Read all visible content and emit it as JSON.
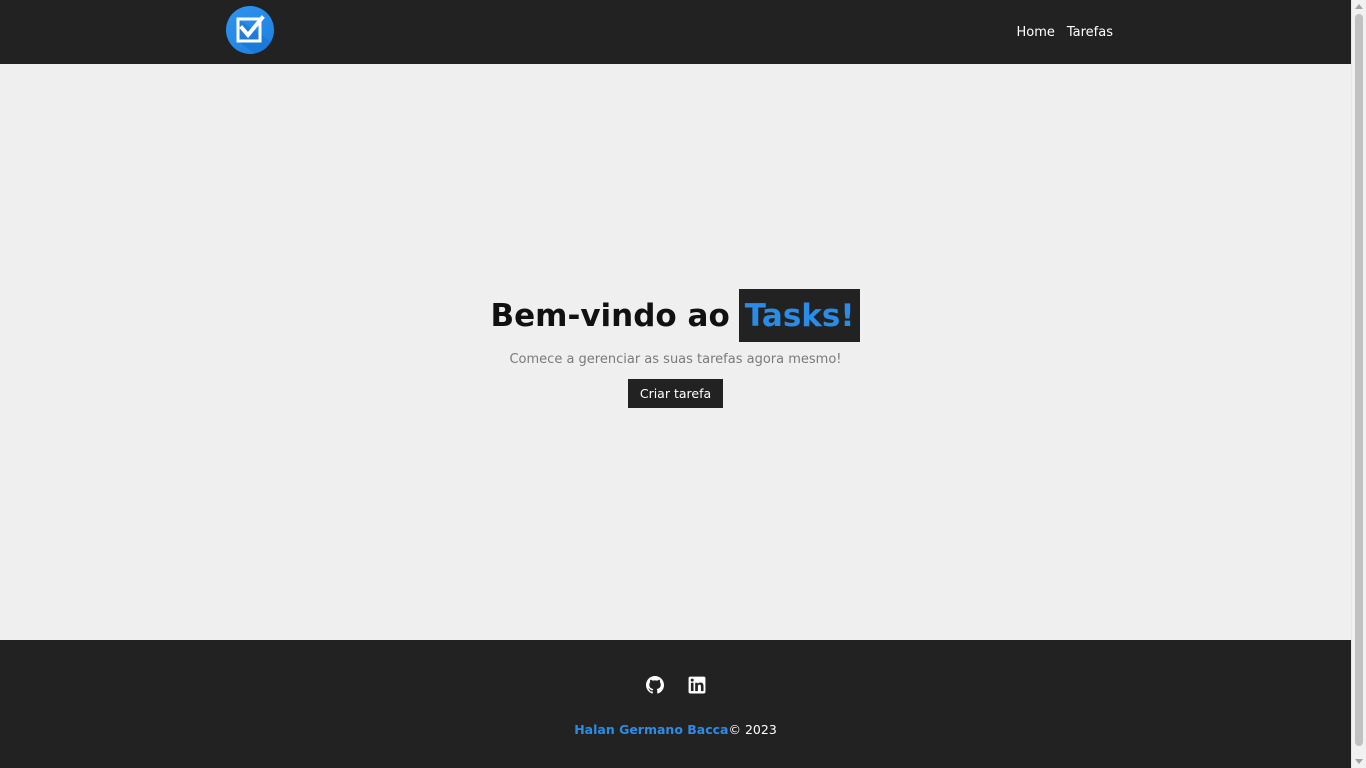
{
  "header": {
    "logo_icon": "checkbox-check-icon",
    "nav": {
      "home": "Home",
      "tasks": "Tarefas"
    }
  },
  "hero": {
    "title_prefix": "Bem-vindo ao",
    "title_brand": "Tasks!",
    "subtitle": "Comece a gerenciar as suas tarefas agora mesmo!",
    "cta_label": "Criar tarefa"
  },
  "footer": {
    "social_icons": [
      "github-icon",
      "linkedin-icon"
    ],
    "author": "Halan Germano Bacca",
    "copyright": "© 2023"
  },
  "colors": {
    "header_bg": "#222222",
    "accent": "#2b8ce8",
    "page_bg": "#efefef"
  }
}
